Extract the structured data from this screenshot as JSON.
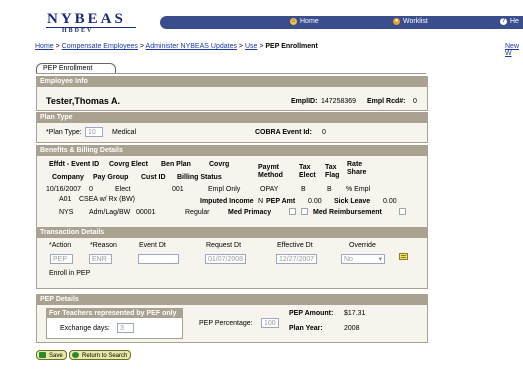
{
  "header": {
    "logo_main": "NYBEAS",
    "logo_sub": "HBDEV",
    "nav_home": "Home",
    "nav_worklist": "Worklist",
    "nav_help": "He"
  },
  "breadcrumb": {
    "home": "Home",
    "compensate": "Compensate Employees",
    "administer": "Administer NYBEAS Updates",
    "use": "Use",
    "current": "PEP Enrollment",
    "sep": " > ",
    "new_window": "New W"
  },
  "tab": {
    "label": "PEP Enrollment"
  },
  "employee_info": {
    "title": "Employee Info",
    "name": "Tester,Thomas A.",
    "emplid_label": "EmplID:",
    "emplid": "147258369",
    "emplrcd_label": "Empl Rcd#:",
    "emplrcd": "0"
  },
  "plan_type": {
    "title": "Plan Type",
    "label": "*Plan Type:",
    "value": "10",
    "desc": "Medical",
    "cobra_label": "COBRA Event Id:",
    "cobra_value": "0"
  },
  "benefits": {
    "title": "Benefits & Billing Details",
    "h_effdt": "Effdt - Event ID",
    "h_covrg_elect": "Covrg Elect",
    "h_ben_plan": "Ben Plan",
    "h_covrg": "Covrg",
    "h_paymt1": "Paymt",
    "h_paymt2": "Method",
    "h_tax_elect1": "Tax",
    "h_tax_elect2": "Elect",
    "h_tax_flag1": "Tax",
    "h_tax_flag2": "Flag",
    "h_rate1": "Rate",
    "h_rate2": "Share",
    "h_company": "Company",
    "h_paygroup": "Pay Group",
    "h_custid": "Cust ID",
    "h_billing": "Billing Status",
    "r_effdt": "10/16/2007",
    "r_event": "0",
    "r_elect": "Elect",
    "r_plan": "001",
    "r_covrg": "Empl Only",
    "r_paymt": "OPAY",
    "r_taxelect": "B",
    "r_taxflag": "B",
    "r_rate": "% Empl",
    "r_a01": "A01",
    "r_a01desc": "CSEA w/ Rx (BW)",
    "imputed_label": "Imputed Income",
    "imputed_value": "N",
    "pep_amt_label": "PEP Amt",
    "pep_amt_value": "0.00",
    "sick_label": "Sick Leave",
    "sick_value": "0.00",
    "r_company": "NYS",
    "r_paygroup": "Adm/Lag/BW",
    "r_custid": "00001",
    "r_billing": "Regular",
    "med_primacy": "Med Primacy",
    "med_reimb": "Med Reimbursement"
  },
  "transaction": {
    "title": "Transaction Details",
    "h_action": "*Action",
    "h_reason": "*Reason",
    "h_eventdt": "Event Dt",
    "h_requestdt": "Request Dt",
    "h_effectivedt": "Effective Dt",
    "h_override": "Override",
    "action": "PEP",
    "reason": "ENR",
    "event_dt": "",
    "request_dt": "01/07/2008",
    "effective_dt": "12/27/2007",
    "override": "No",
    "status": "Enroll in PEP"
  },
  "pep": {
    "title": "PEP Details",
    "teachers_title": "For Teachers represented by PEF only",
    "exchange_label": "Exchange days:",
    "exchange_value": "3",
    "pct_label": "PEP Percentage:",
    "pct_value": "100",
    "amount_label": "PEP Amount:",
    "amount_value": "$17.31",
    "year_label": "Plan Year:",
    "year_value": "2008"
  },
  "buttons": {
    "save": "Save",
    "return": "Return to Search"
  },
  "colors": {
    "section_header": "#a9a291",
    "section_bg": "#f6f4ec",
    "navbar": "#3a4e8e"
  }
}
